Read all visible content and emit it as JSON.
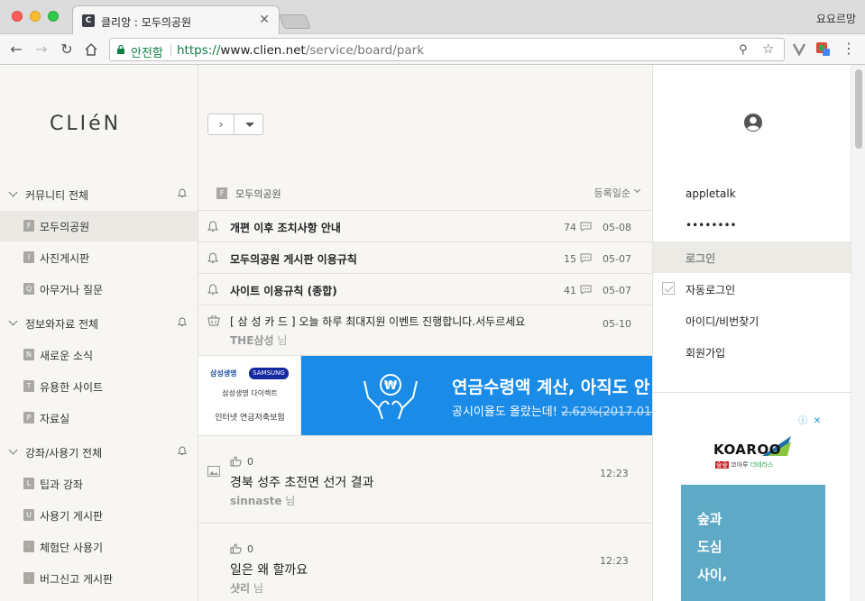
{
  "window": {
    "tab_title": "클리앙 : 모두의공원",
    "profile_name": "요요르망"
  },
  "addressbar": {
    "secure_label": "안전함",
    "url_scheme": "https://",
    "url_host": "www.clien.net",
    "url_path": "/service/board/park"
  },
  "left_menu": {
    "logo": "CLIéN",
    "groups": [
      {
        "label": "커뮤니티 전체",
        "items": [
          {
            "badge": "F",
            "label": "모두의공원",
            "active": true
          },
          {
            "badge": "I",
            "label": "사진게시판"
          },
          {
            "badge": "Q",
            "label": "아무거나 질문"
          }
        ]
      },
      {
        "label": "정보와자료 전체",
        "items": [
          {
            "badge": "N",
            "label": "새로운 소식"
          },
          {
            "badge": "T",
            "label": "유용한 사이트"
          },
          {
            "badge": "P",
            "label": "자료실"
          }
        ]
      },
      {
        "label": "강좌/사용기 전체",
        "items": [
          {
            "badge": "L",
            "label": "팁과 강좌"
          },
          {
            "badge": "U",
            "label": "사용기 게시판"
          },
          {
            "badge": "·",
            "label": "체험단 사용기"
          },
          {
            "badge": "·",
            "label": "버그신고 게시판"
          }
        ]
      }
    ]
  },
  "board": {
    "badge": "F",
    "name": "모두의공원",
    "sort_label": "등록일순",
    "notices": [
      {
        "title": "개편 이후 조치사항 안내",
        "comments": "74",
        "date": "05-08"
      },
      {
        "title": "모두의공원 게시판 이용규칙",
        "comments": "15",
        "date": "05-07"
      },
      {
        "title": "사이트 이용규칙 (종합)",
        "comments": "41",
        "date": "05-07"
      }
    ],
    "ad_post": {
      "title": "[ 삼 성 카 드 ] 오늘 하루 최대지원 이벤트 진행합니다.서두르세요",
      "date": "05-10",
      "author": "THE삼성",
      "author_suffix": "님"
    },
    "banner": {
      "left_line1": "삼성생명",
      "left_brand": "SAMSUNG",
      "left_line2": "삼성생명 다이렉트",
      "left_line3": "인터넷 연금저축보험",
      "headline": "연금수령액 계산, 아직도 안 하",
      "subline": "공시이율도 올랐는데!",
      "subline_strike": "2.62%(2017.01)"
    },
    "posts": [
      {
        "likes": "0",
        "title": "경북 성주 초전면 선거 결과",
        "time": "12:23",
        "author": "sinnaste",
        "author_suffix": "님",
        "has_image": true
      },
      {
        "likes": "0",
        "title": "일은 왜 할까요",
        "time": "12:23",
        "author": "샷리",
        "author_suffix": "님",
        "has_image": false
      }
    ]
  },
  "account": {
    "username": "appletalk",
    "password_mask": "••••••••",
    "login_label": "로그인",
    "auto_login_label": "자동로그인",
    "find_label": "아이디/비번찾기",
    "signup_label": "회원가입"
  },
  "side_ad": {
    "brand": "KOAROO",
    "sub_red": "숲숲",
    "sub_mid": "코아루",
    "sub_green": "더테라스",
    "lines": [
      "숲과",
      "도심",
      "사이,"
    ]
  },
  "colors": {
    "accent_green": "#0b8043",
    "banner_blue": "#1a8ce8",
    "side_ad_blue": "#5ea9c6"
  }
}
